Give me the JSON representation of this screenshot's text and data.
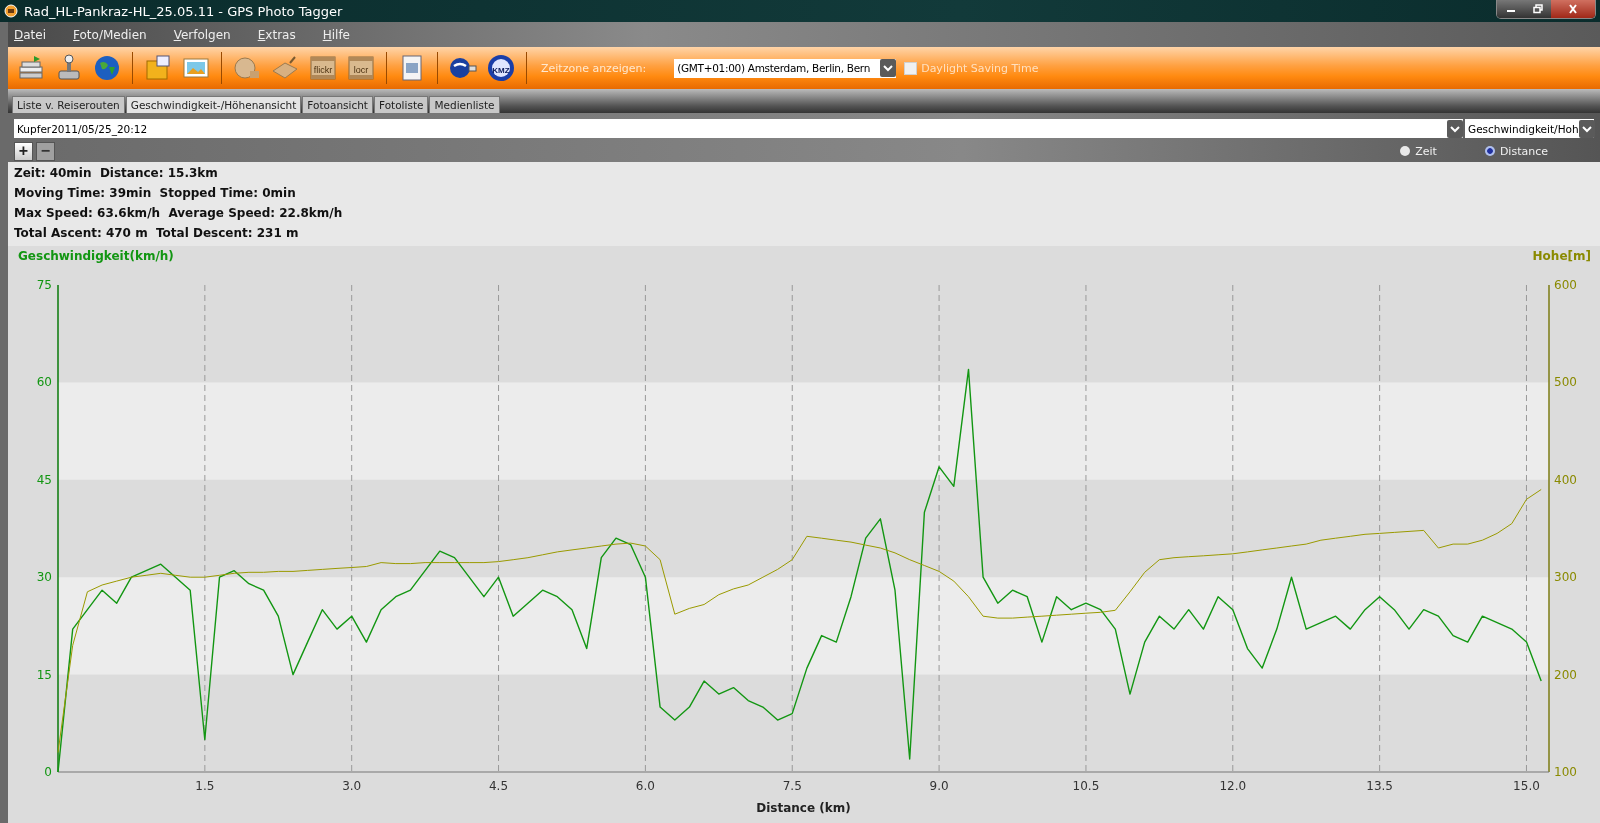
{
  "window": {
    "title": "Rad_HL-Pankraz-HL_25.05.11 - GPS Photo Tagger"
  },
  "menu": [
    "Datei",
    "Foto/Medien",
    "Verfolgen",
    "Extras",
    "Hilfe"
  ],
  "toolbar": {
    "flickr_label": "flickr",
    "locr_label": "locr",
    "kmz_label": "KMZ",
    "timezone_label": "Zeitzone anzeigen:",
    "timezone_value": "(GMT+01:00) Amsterdam, Berlin, Bern",
    "daylight_saving": {
      "label": "Daylight Saving Time",
      "checked": false
    }
  },
  "tabs": [
    {
      "label": "Liste v. Reiserouten",
      "selected": false
    },
    {
      "label": "Geschwindigkeit-/Höhenansicht",
      "selected": true
    },
    {
      "label": "Fotoansicht",
      "selected": false
    },
    {
      "label": "Fotoliste",
      "selected": false
    },
    {
      "label": "Medienliste",
      "selected": false
    }
  ],
  "track_select": {
    "value": "Kupfer2011/05/25_20:12"
  },
  "view_select": {
    "value": "Geschwindigkeit/Hoh"
  },
  "zoom_in": {
    "label": "+",
    "disabled": false
  },
  "zoom_out": {
    "label": "−",
    "disabled": true
  },
  "axis_mode": [
    {
      "label": "Zeit",
      "selected": false
    },
    {
      "label": "Distance",
      "selected": true
    }
  ],
  "stats": [
    "Zeit: 40min  Distance: 15.3km",
    "Moving Time: 39min  Stopped Time: 0min",
    "Max Speed: 63.6km/h  Average Speed: 22.8km/h",
    "Total Ascent: 470 m  Total Descent: 231 m"
  ],
  "chart": {
    "chart_data": {
      "type": "line",
      "xlabel": "Distance (km)",
      "ylabel": "Geschwindigkeit(km/h)",
      "y2label": "Hohe[m]",
      "xlim": [
        0,
        15.23
      ],
      "ylim": [
        0,
        75
      ],
      "y2lim": [
        100,
        600
      ],
      "xticks": [
        {
          "value": 1.5,
          "label": "1.5"
        },
        {
          "value": 3,
          "label": "3.0"
        },
        {
          "value": 4.5,
          "label": "4.5"
        },
        {
          "value": 6,
          "label": "6.0"
        },
        {
          "value": 7.5,
          "label": "7.5"
        },
        {
          "value": 9,
          "label": "9.0"
        },
        {
          "value": 10.5,
          "label": "10.5"
        },
        {
          "value": 12,
          "label": "12.0"
        },
        {
          "value": 13.5,
          "label": "13.5"
        },
        {
          "value": 15,
          "label": "15.0"
        }
      ],
      "yticks": [
        0,
        15,
        30,
        45,
        60,
        75
      ],
      "y2ticks": [
        100,
        200,
        300,
        400,
        500,
        600
      ],
      "grid": true,
      "x": [
        0,
        0.15,
        0.3,
        0.45,
        0.6,
        0.75,
        0.9,
        1.05,
        1.2,
        1.35,
        1.5,
        1.65,
        1.8,
        1.95,
        2.1,
        2.25,
        2.4,
        2.55,
        2.7,
        2.85,
        3,
        3.15,
        3.3,
        3.45,
        3.6,
        3.75,
        3.9,
        4.05,
        4.2,
        4.35,
        4.5,
        4.65,
        4.8,
        4.95,
        5.1,
        5.25,
        5.4,
        5.55,
        5.7,
        5.85,
        6,
        6.15,
        6.3,
        6.45,
        6.6,
        6.75,
        6.9,
        7.05,
        7.2,
        7.35,
        7.5,
        7.65,
        7.8,
        7.95,
        8.1,
        8.25,
        8.4,
        8.55,
        8.7,
        8.85,
        9,
        9.15,
        9.3,
        9.45,
        9.6,
        9.75,
        9.9,
        10.05,
        10.2,
        10.35,
        10.5,
        10.65,
        10.8,
        10.95,
        11.1,
        11.25,
        11.4,
        11.55,
        11.7,
        11.85,
        12,
        12.15,
        12.3,
        12.45,
        12.6,
        12.75,
        12.9,
        13.05,
        13.2,
        13.35,
        13.5,
        13.65,
        13.8,
        13.95,
        14.1,
        14.25,
        14.4,
        14.55,
        14.7,
        14.85,
        15,
        15.15
      ],
      "series": [
        {
          "color": "#129612",
          "values": [
            0,
            22,
            25,
            28,
            26,
            30,
            31,
            32,
            30,
            28,
            5,
            30,
            31,
            29,
            28,
            24,
            15,
            20,
            25,
            22,
            24,
            20,
            25,
            27,
            28,
            31,
            34,
            33,
            30,
            27,
            30,
            24,
            26,
            28,
            27,
            25,
            19,
            33,
            36,
            35,
            30,
            10,
            8,
            10,
            14,
            12,
            13,
            11,
            10,
            8,
            9,
            16,
            21,
            20,
            27,
            36,
            39,
            28,
            2,
            40,
            47,
            44,
            62,
            30,
            26,
            28,
            27,
            20,
            27,
            25,
            26,
            25,
            22,
            12,
            20,
            24,
            22,
            25,
            22,
            27,
            25,
            19,
            16,
            22,
            30,
            22,
            23,
            24,
            22,
            25,
            27,
            25,
            22,
            25,
            24,
            21,
            20,
            24,
            23,
            22,
            20,
            14
          ]
        },
        {
          "color": "#9a9a00",
          "axis": "y2",
          "values": [
            120,
            230,
            285,
            292,
            296,
            300,
            302,
            304,
            302,
            300,
            300,
            302,
            304,
            305,
            305,
            306,
            306,
            307,
            308,
            309,
            310,
            311,
            315,
            314,
            314,
            315,
            315,
            315,
            315,
            315,
            316,
            318,
            320,
            323,
            326,
            328,
            330,
            332,
            334,
            335,
            332,
            318,
            262,
            268,
            272,
            282,
            288,
            292,
            300,
            308,
            318,
            342,
            340,
            338,
            336,
            333,
            330,
            325,
            318,
            312,
            306,
            296,
            280,
            260,
            258,
            258,
            259,
            260,
            261,
            262,
            263,
            264,
            266,
            285,
            305,
            318,
            320,
            321,
            322,
            323,
            324,
            326,
            328,
            330,
            332,
            334,
            338,
            340,
            342,
            344,
            345,
            346,
            347,
            348,
            330,
            334,
            334,
            338,
            345,
            355,
            380,
            390
          ]
        }
      ]
    }
  }
}
